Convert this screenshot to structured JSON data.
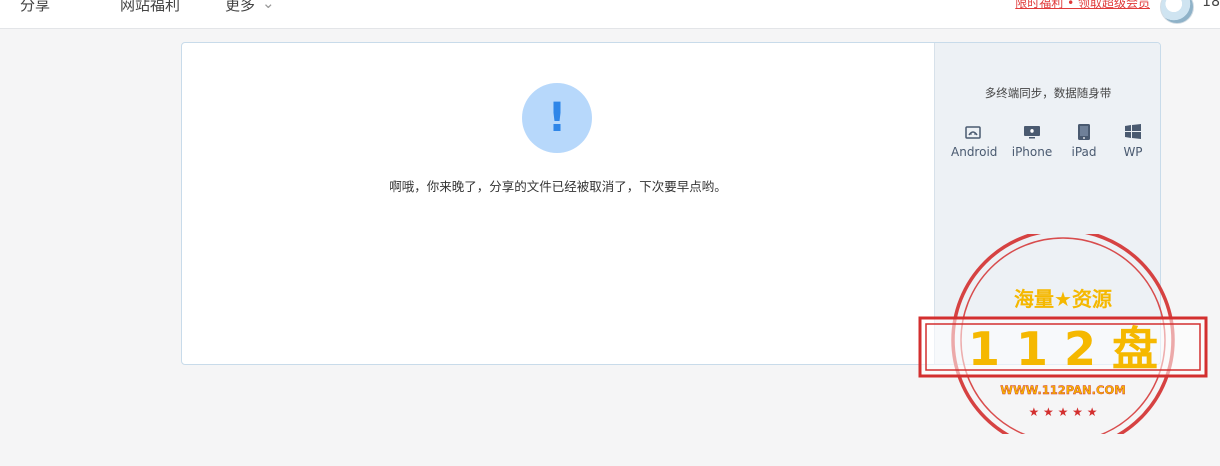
{
  "nav": {
    "items": [
      "分享",
      "网站福利",
      "更多"
    ],
    "promo": "限时福利 • 领取超级会员",
    "user_number": "18"
  },
  "notice": {
    "icon": "exclamation-icon",
    "icon_glyph": "!",
    "message": "啊哦，你来晚了，分享的文件已经被取消了，下次要早点哟。"
  },
  "sidebar": {
    "title": "多终端同步，数据随身带",
    "platforms": [
      {
        "name": "Android",
        "icon": "android-icon"
      },
      {
        "name": "iPhone",
        "icon": "iphone-icon"
      },
      {
        "name": "iPad",
        "icon": "ipad-icon"
      },
      {
        "name": "WP",
        "icon": "windows-icon"
      }
    ]
  },
  "watermark": {
    "top_text": "海量★资源",
    "main_text": "1 1 2 盘",
    "url": "WWW.112PAN.COM",
    "color": "#d32f2f",
    "accent": "#f5b800"
  },
  "colors": {
    "accent": "#2f86e8",
    "icon_bg": "#b7d8fb",
    "link_red": "#e03a3a"
  }
}
